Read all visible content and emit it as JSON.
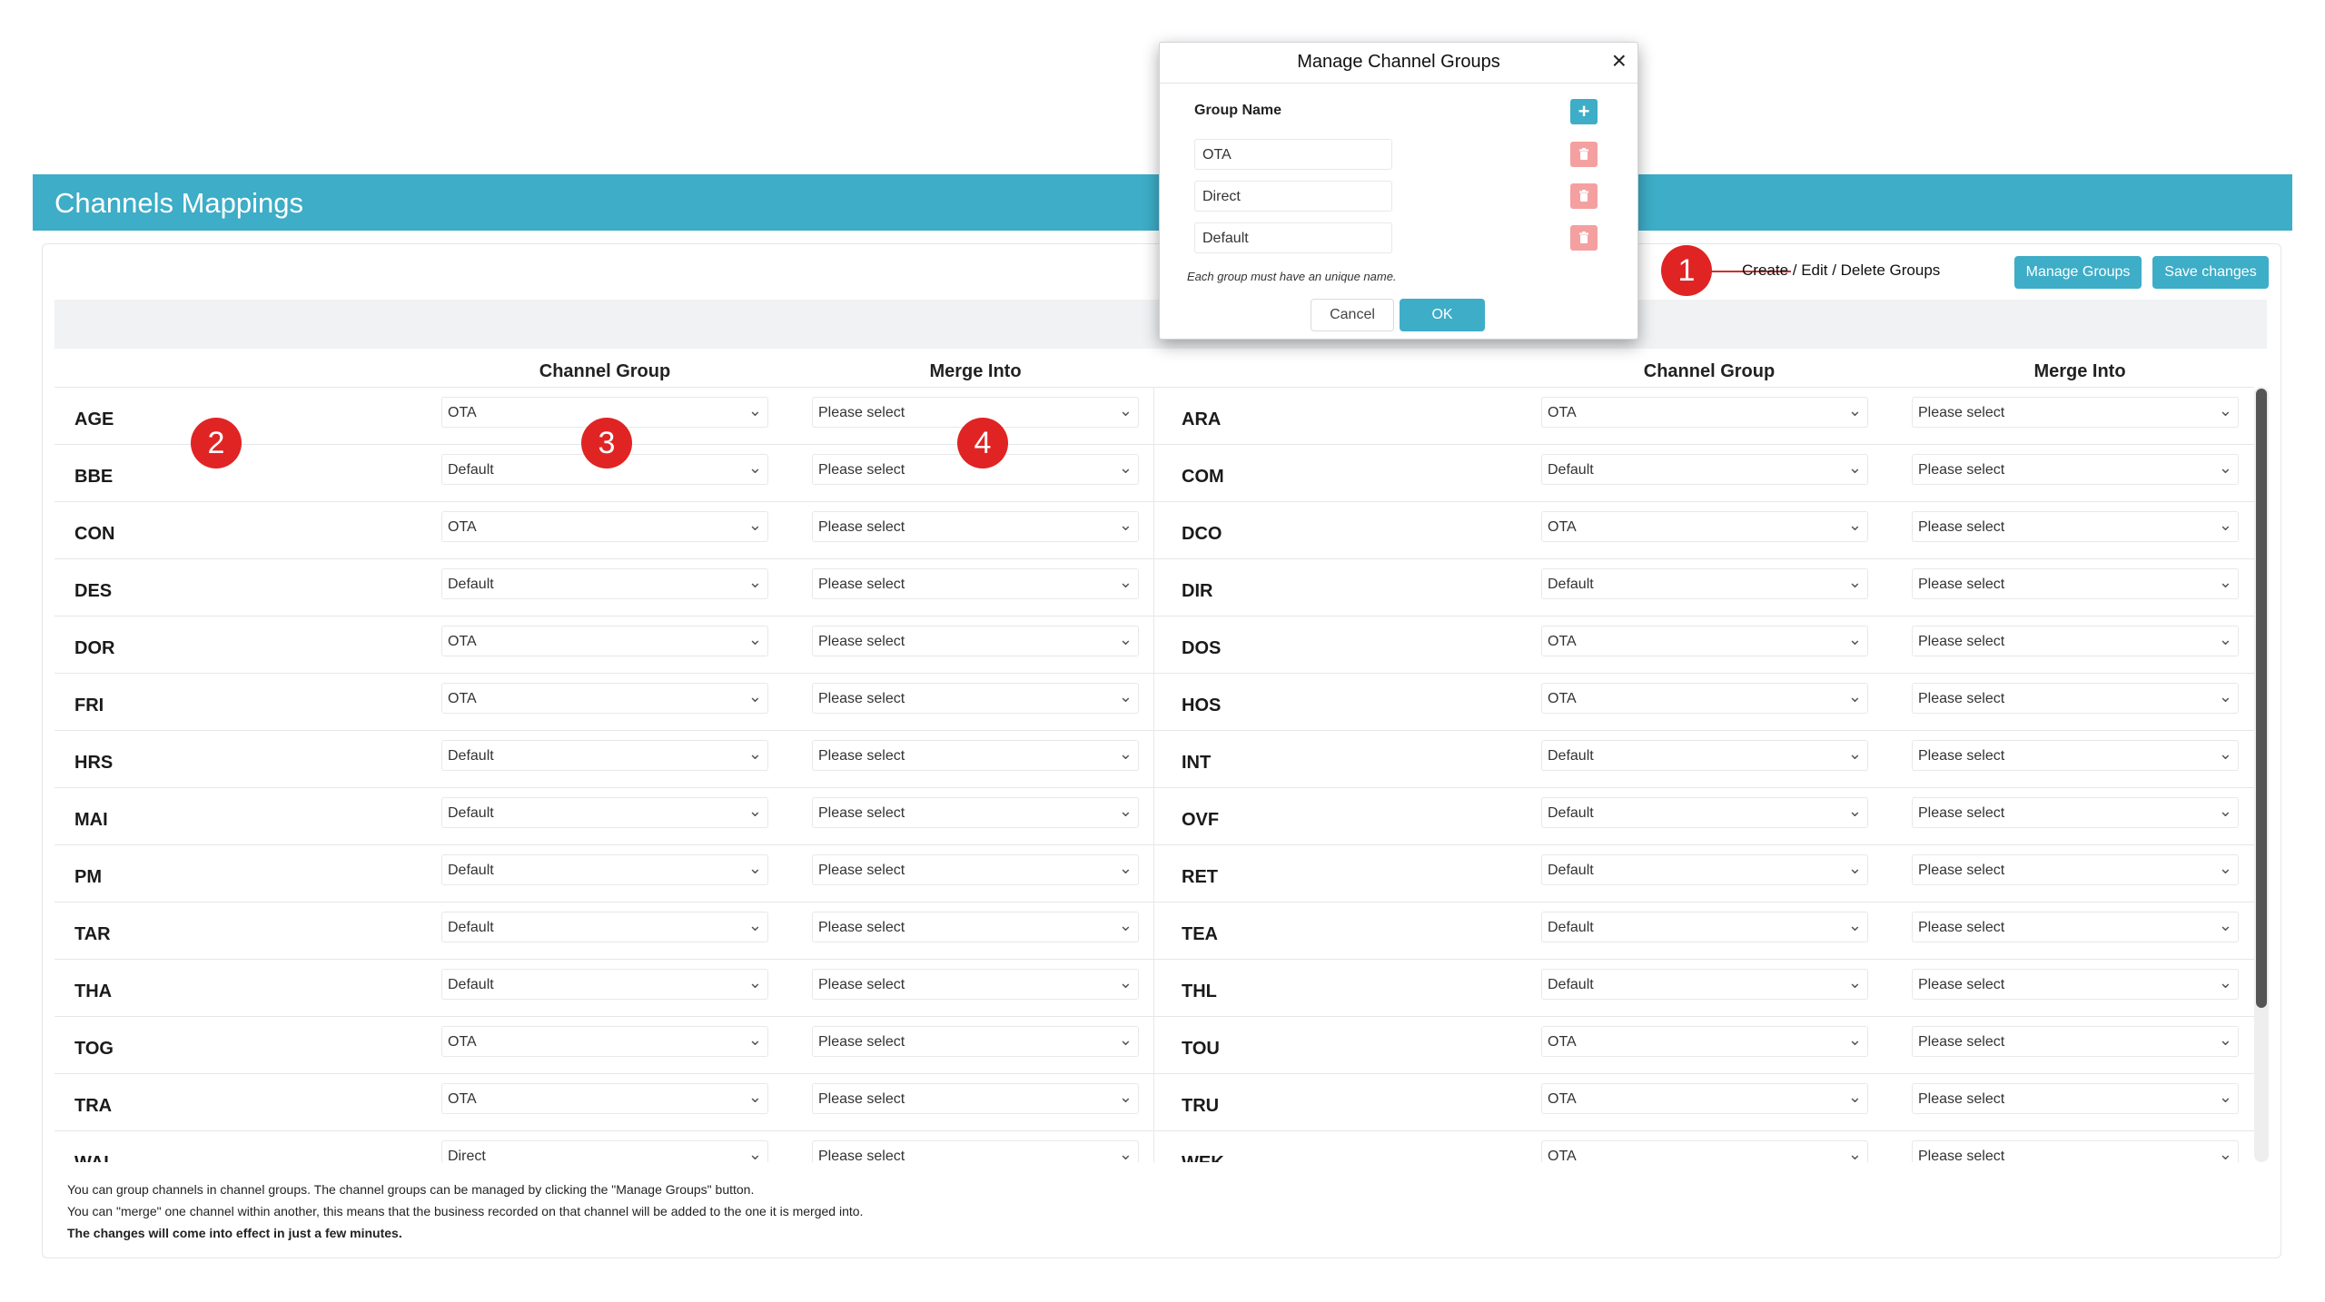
{
  "app": {
    "title": "Channels Mappings"
  },
  "toolbar": {
    "hint": "Create / Edit / Delete Groups",
    "manage_label": "Manage Groups",
    "save_label": "Save changes"
  },
  "columns": {
    "group": "Channel Group",
    "merge": "Merge Into"
  },
  "rows_left": [
    {
      "code": "AGE",
      "group": "OTA",
      "merge": "Please select"
    },
    {
      "code": "BBE",
      "group": "Default",
      "merge": "Please select"
    },
    {
      "code": "CON",
      "group": "OTA",
      "merge": "Please select"
    },
    {
      "code": "DES",
      "group": "Default",
      "merge": "Please select"
    },
    {
      "code": "DOR",
      "group": "OTA",
      "merge": "Please select"
    },
    {
      "code": "FRI",
      "group": "OTA",
      "merge": "Please select"
    },
    {
      "code": "HRS",
      "group": "Default",
      "merge": "Please select"
    },
    {
      "code": "MAI",
      "group": "Default",
      "merge": "Please select"
    },
    {
      "code": "PM",
      "group": "Default",
      "merge": "Please select"
    },
    {
      "code": "TAR",
      "group": "Default",
      "merge": "Please select"
    },
    {
      "code": "THA",
      "group": "Default",
      "merge": "Please select"
    },
    {
      "code": "TOG",
      "group": "OTA",
      "merge": "Please select"
    },
    {
      "code": "TRA",
      "group": "OTA",
      "merge": "Please select"
    },
    {
      "code": "WAI",
      "group": "Direct",
      "merge": "Please select"
    }
  ],
  "rows_right": [
    {
      "code": "ARA",
      "group": "OTA",
      "merge": "Please select"
    },
    {
      "code": "COM",
      "group": "Default",
      "merge": "Please select"
    },
    {
      "code": "DCO",
      "group": "OTA",
      "merge": "Please select"
    },
    {
      "code": "DIR",
      "group": "Default",
      "merge": "Please select"
    },
    {
      "code": "DOS",
      "group": "OTA",
      "merge": "Please select"
    },
    {
      "code": "HOS",
      "group": "OTA",
      "merge": "Please select"
    },
    {
      "code": "INT",
      "group": "Default",
      "merge": "Please select"
    },
    {
      "code": "OVF",
      "group": "Default",
      "merge": "Please select"
    },
    {
      "code": "RET",
      "group": "Default",
      "merge": "Please select"
    },
    {
      "code": "TEA",
      "group": "Default",
      "merge": "Please select"
    },
    {
      "code": "THL",
      "group": "Default",
      "merge": "Please select"
    },
    {
      "code": "TOU",
      "group": "OTA",
      "merge": "Please select"
    },
    {
      "code": "TRU",
      "group": "OTA",
      "merge": "Please select"
    },
    {
      "code": "WEK",
      "group": "OTA",
      "merge": "Please select"
    }
  ],
  "notes": {
    "line1": "You can group channels in channel groups. The channel groups can be managed by clicking the \"Manage Groups\" button.",
    "line2": "You can \"merge\" one channel within another, this means that the business recorded on that channel will be added to the one it is merged into.",
    "line3": "The changes will come into effect in just a few minutes."
  },
  "badges": [
    "1",
    "2",
    "3",
    "4"
  ],
  "modal": {
    "title": "Manage Channel Groups",
    "close": "×",
    "group_name_label": "Group Name",
    "add": "+",
    "groups": [
      "OTA",
      "Direct",
      "Default"
    ],
    "note": "Each group must have an unique name.",
    "cancel": "Cancel",
    "ok": "OK"
  },
  "colors": {
    "accent": "#3eadc7",
    "badge": "#e02424",
    "delete": "#f5a0a0"
  },
  "icons": {
    "chevron": "chevron-down-icon",
    "trash": "trash-icon",
    "close": "close-icon",
    "plus": "plus-icon"
  }
}
